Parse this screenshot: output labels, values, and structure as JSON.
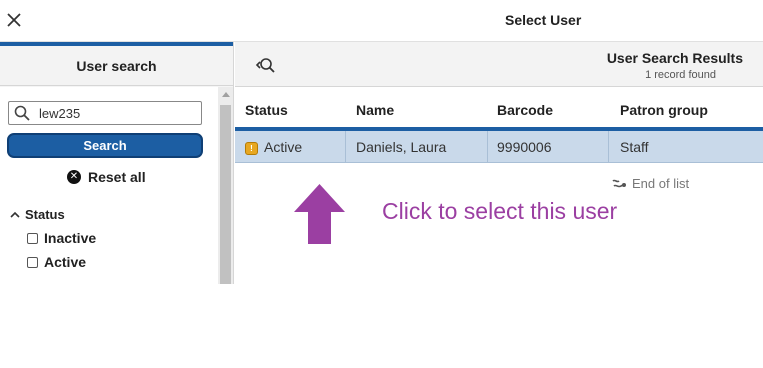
{
  "header": {
    "title": "Select User"
  },
  "left_pane": {
    "title": "User search",
    "search": {
      "value": "lew235",
      "placeholder": ""
    },
    "search_button": "Search",
    "reset_all": "Reset all",
    "filters": {
      "status_label": "Status",
      "options": [
        "Inactive",
        "Active"
      ]
    }
  },
  "results": {
    "title": "User Search Results",
    "count": "1 record found",
    "columns": [
      "Status",
      "Name",
      "Barcode",
      "Patron group"
    ],
    "rows": [
      {
        "status": "Active",
        "name": "Daniels, Laura",
        "barcode": "9990006",
        "patron_group": "Staff"
      }
    ],
    "end_of_list": "End of list"
  },
  "annotation": {
    "text": "Click to select this user",
    "color": "#9b3fa2"
  },
  "colors": {
    "accent": "#1c5ea3",
    "selected_row": "#c9d9ea",
    "status_icon": "#e7a721"
  },
  "icons": [
    "close-icon",
    "search-icon",
    "collapse-search-icon",
    "x-circle-icon",
    "chevron-up-icon",
    "status-warning-icon",
    "end-of-list-icon",
    "up-arrow-icon"
  ]
}
